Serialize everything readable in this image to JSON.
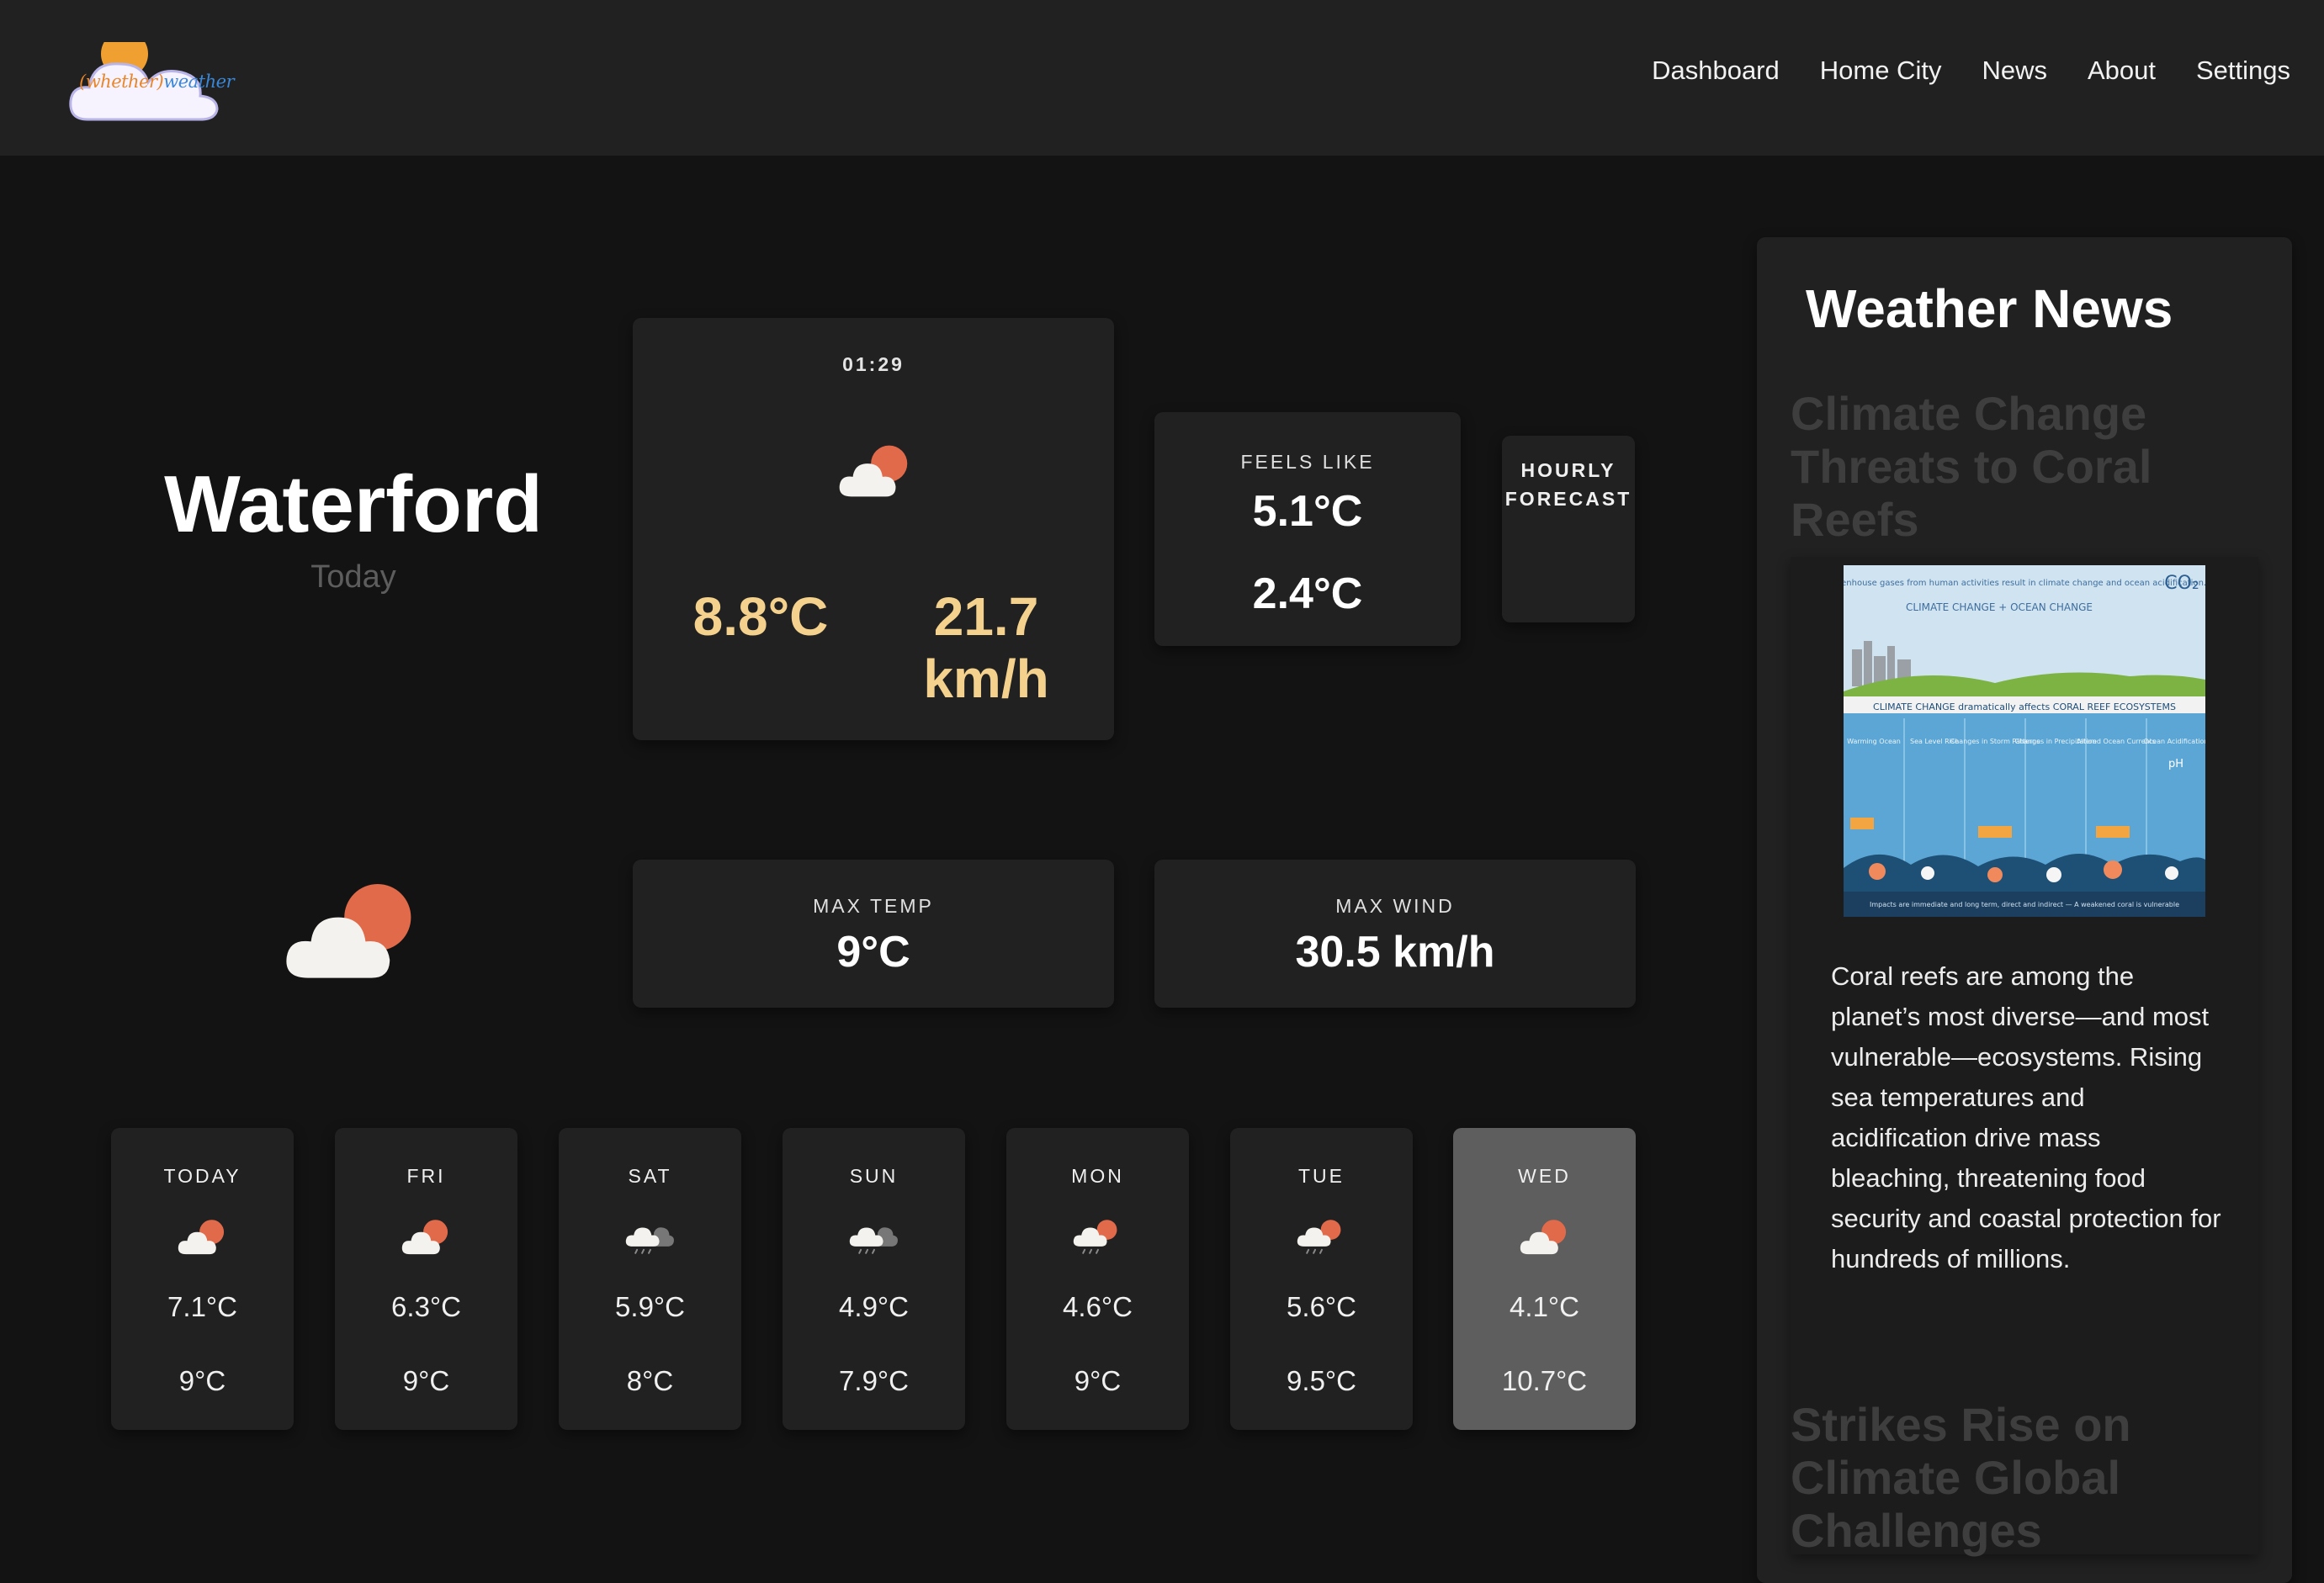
{
  "header": {
    "logo": {
      "part1": "(whether)",
      "part2": "weather"
    },
    "nav": [
      "Dashboard",
      "Home City",
      "News",
      "About",
      "Settings"
    ]
  },
  "location": {
    "city": "Waterford",
    "day": "Today"
  },
  "current": {
    "time": "01:29",
    "temperature": "8.8°C",
    "wind": "21.7 km/h",
    "icon": "partly-cloudy-icon"
  },
  "feels_like": {
    "label": "FEELS LIKE",
    "value": "5.1°C",
    "value2": "2.4°C"
  },
  "hourly": {
    "label": "HOURLY FORECAST"
  },
  "max_temp": {
    "label": "MAX TEMP",
    "value": "9°C"
  },
  "max_wind": {
    "label": "MAX WIND",
    "value": "30.5 km/h"
  },
  "forecast": [
    {
      "day": "TODAY",
      "low": "7.1°C",
      "high": "9°C",
      "icon": "partly-cloudy-icon"
    },
    {
      "day": "FRI",
      "low": "6.3°C",
      "high": "9°C",
      "icon": "partly-cloudy-icon"
    },
    {
      "day": "SAT",
      "low": "5.9°C",
      "high": "8°C",
      "icon": "rain-cloud-icon"
    },
    {
      "day": "SUN",
      "low": "4.9°C",
      "high": "7.9°C",
      "icon": "rain-cloud-icon"
    },
    {
      "day": "MON",
      "low": "4.6°C",
      "high": "9°C",
      "icon": "sun-rain-cloud-icon"
    },
    {
      "day": "TUE",
      "low": "5.6°C",
      "high": "9.5°C",
      "icon": "sun-rain-cloud-icon"
    },
    {
      "day": "WED",
      "low": "4.1°C",
      "high": "10.7°C",
      "icon": "partly-cloudy-icon"
    }
  ],
  "colors": {
    "accent_temp": "#f4d28e",
    "sun": "#e06a4a",
    "card": "#212121",
    "active_card": "#5e5e5e"
  },
  "news": {
    "heading": "Weather News",
    "articles": [
      {
        "title": "Climate Change Threats to Coral Reefs",
        "image": {
          "top_text": "Increased greenhouse gases from human activities result in climate change and ocean acidification.",
          "co2": "CO₂",
          "subtitle": "CLIMATE CHANGE + OCEAN CHANGE",
          "band": "CLIMATE CHANGE dramatically affects CORAL REEF ECOSYSTEMS",
          "labels": [
            "Warming Ocean",
            "Sea Level Rise",
            "Changes in Storm Patterns",
            "Changes in Precipitation",
            "Altered Ocean Currents",
            "Ocean Acidification"
          ],
          "ph": "pH",
          "footer": "Impacts are immediate and long term, direct and indirect — A weakened coral is vulnerable"
        },
        "body": "Coral reefs are among the planet’s most diverse—and most vulnerable—ecosystems. Rising sea temperatures and acidification drive mass bleaching, threatening food security and coastal protection for hundreds of millions."
      },
      {
        "title": "Strikes Rise on Climate Global Challenges"
      }
    ]
  }
}
